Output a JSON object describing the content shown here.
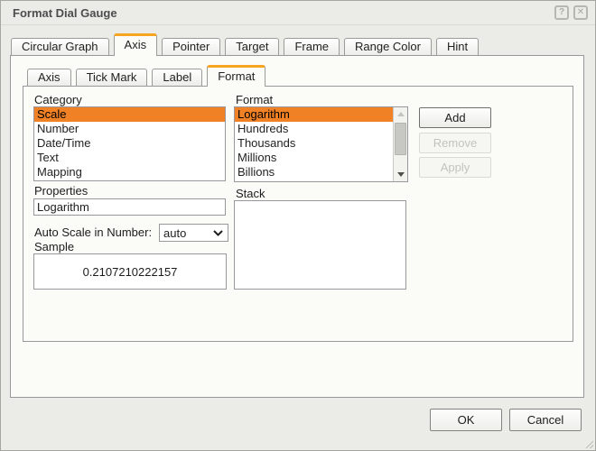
{
  "window": {
    "title": "Format Dial Gauge",
    "help_icon": "?",
    "close_icon": "✕"
  },
  "colors": {
    "selection_orange": "#f08125",
    "tab_accent_orange": "#f7a521",
    "dialog_bg": "#ebebe8",
    "panel_bg": "#fbfcf7"
  },
  "main_tabs": {
    "items": [
      "Circular Graph",
      "Axis",
      "Pointer",
      "Target",
      "Frame",
      "Range Color",
      "Hint"
    ],
    "selected": "Axis"
  },
  "sub_tabs": {
    "items": [
      "Axis",
      "Tick Mark",
      "Label",
      "Format"
    ],
    "selected": "Format"
  },
  "format_tab": {
    "category": {
      "label": "Category",
      "items": [
        "Scale",
        "Number",
        "Date/Time",
        "Text",
        "Mapping"
      ],
      "selected": "Scale"
    },
    "format": {
      "label": "Format",
      "items": [
        "Logarithm",
        "Hundreds",
        "Thousands",
        "Millions",
        "Billions"
      ],
      "selected": "Logarithm"
    },
    "buttons": {
      "add": "Add",
      "remove": "Remove",
      "apply": "Apply"
    },
    "properties": {
      "label": "Properties",
      "value": "Logarithm"
    },
    "auto_scale": {
      "label": "Auto Scale in Number:",
      "value": "auto"
    },
    "sample": {
      "label": "Sample",
      "value": "0.2107210222157"
    },
    "stack": {
      "label": "Stack"
    }
  },
  "footer": {
    "ok": "OK",
    "cancel": "Cancel"
  }
}
